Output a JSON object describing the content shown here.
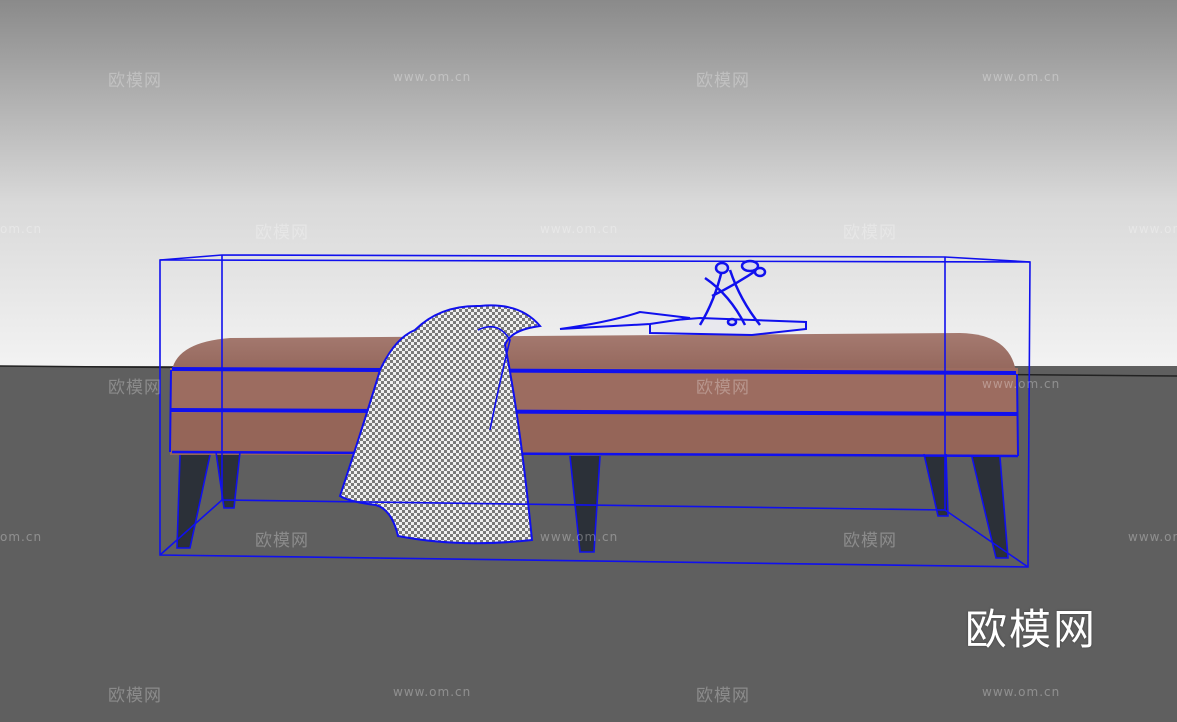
{
  "watermark": {
    "brand_text": "欧模网",
    "url_text": "www.om.cn",
    "url_text_cropped": "om.cn"
  },
  "logo_text": "欧模网",
  "scene": {
    "object": "bench-ottoman-3d-model",
    "selection_color": "#1010ee",
    "upholstery_color": "#9e6e63",
    "leg_color": "#2b3038",
    "floor_color": "#5f5f5f",
    "sky_top_color": "#8c8c8c",
    "sky_horizon_color": "#f2f2f2"
  }
}
